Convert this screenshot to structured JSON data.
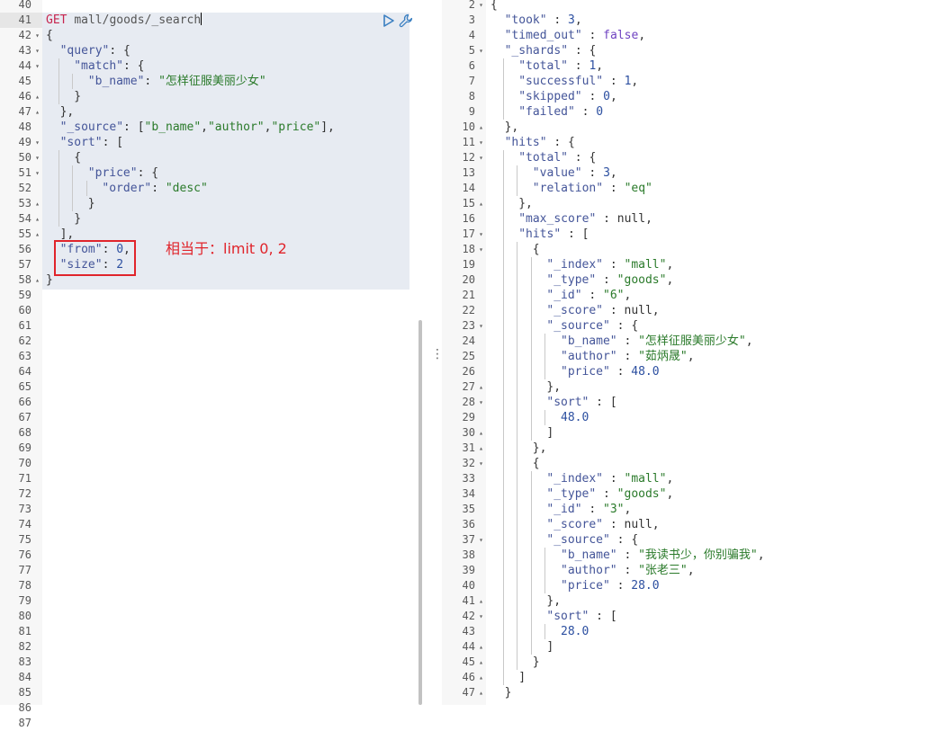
{
  "request": {
    "method": "GET",
    "path": "mall/goods/_search",
    "first_line": 40,
    "lines": [
      [],
      [],
      [
        {
          "t": "p",
          "v": "{"
        }
      ],
      [
        {
          "t": "k",
          "v": "\"query\""
        },
        {
          "t": "p",
          "v": ": {"
        }
      ],
      [
        {
          "t": "k",
          "v": "\"match\""
        },
        {
          "t": "p",
          "v": ": {"
        }
      ],
      [
        {
          "t": "k",
          "v": "\"b_name\""
        },
        {
          "t": "p",
          "v": ": "
        },
        {
          "t": "s",
          "v": "\"怎样征服美丽少女\""
        }
      ],
      [
        {
          "t": "p",
          "v": "}"
        }
      ],
      [
        {
          "t": "p",
          "v": "},"
        }
      ],
      [
        {
          "t": "k",
          "v": "\"_source\""
        },
        {
          "t": "p",
          "v": ": ["
        },
        {
          "t": "s",
          "v": "\"b_name\""
        },
        {
          "t": "p",
          "v": ","
        },
        {
          "t": "s",
          "v": "\"author\""
        },
        {
          "t": "p",
          "v": ","
        },
        {
          "t": "s",
          "v": "\"price\""
        },
        {
          "t": "p",
          "v": "],"
        }
      ],
      [
        {
          "t": "k",
          "v": "\"sort\""
        },
        {
          "t": "p",
          "v": ": ["
        }
      ],
      [
        {
          "t": "p",
          "v": "{"
        }
      ],
      [
        {
          "t": "k",
          "v": "\"price\""
        },
        {
          "t": "p",
          "v": ": {"
        }
      ],
      [
        {
          "t": "k",
          "v": "\"order\""
        },
        {
          "t": "p",
          "v": ": "
        },
        {
          "t": "s",
          "v": "\"desc\""
        }
      ],
      [
        {
          "t": "p",
          "v": "}"
        }
      ],
      [
        {
          "t": "p",
          "v": "}"
        }
      ],
      [
        {
          "t": "p",
          "v": "],"
        }
      ],
      [
        {
          "t": "k",
          "v": "\"from\""
        },
        {
          "t": "p",
          "v": ": "
        },
        {
          "t": "n",
          "v": "0"
        },
        {
          "t": "p",
          "v": ","
        }
      ],
      [
        {
          "t": "k",
          "v": "\"size\""
        },
        {
          "t": "p",
          "v": ": "
        },
        {
          "t": "n",
          "v": "2"
        }
      ],
      [
        {
          "t": "p",
          "v": "}"
        }
      ],
      [],
      [],
      [],
      [],
      [],
      [],
      [],
      [],
      [],
      [],
      [],
      [],
      [],
      [],
      [],
      [],
      [],
      [],
      [],
      [],
      [],
      [],
      [],
      [],
      [],
      [],
      [],
      [],
      []
    ],
    "folds": {
      "42": "down",
      "43": "down",
      "44": "down",
      "46": "up",
      "47": "up",
      "49": "down",
      "50": "down",
      "51": "down",
      "53": "up",
      "54": "up",
      "55": "up",
      "58": "up"
    }
  },
  "annotation": {
    "text": "相当于：limit 0, 2"
  },
  "response": {
    "first_line": 2,
    "lines": [
      [
        {
          "t": "p",
          "v": "{"
        }
      ],
      [
        {
          "t": "k",
          "v": "\"took\""
        },
        {
          "t": "p",
          "v": " : "
        },
        {
          "t": "n",
          "v": "3"
        },
        {
          "t": "p",
          "v": ","
        }
      ],
      [
        {
          "t": "k",
          "v": "\"timed_out\""
        },
        {
          "t": "p",
          "v": " : "
        },
        {
          "t": "b",
          "v": "false"
        },
        {
          "t": "p",
          "v": ","
        }
      ],
      [
        {
          "t": "k",
          "v": "\"_shards\""
        },
        {
          "t": "p",
          "v": " : {"
        }
      ],
      [
        {
          "t": "k",
          "v": "\"total\""
        },
        {
          "t": "p",
          "v": " : "
        },
        {
          "t": "n",
          "v": "1"
        },
        {
          "t": "p",
          "v": ","
        }
      ],
      [
        {
          "t": "k",
          "v": "\"successful\""
        },
        {
          "t": "p",
          "v": " : "
        },
        {
          "t": "n",
          "v": "1"
        },
        {
          "t": "p",
          "v": ","
        }
      ],
      [
        {
          "t": "k",
          "v": "\"skipped\""
        },
        {
          "t": "p",
          "v": " : "
        },
        {
          "t": "n",
          "v": "0"
        },
        {
          "t": "p",
          "v": ","
        }
      ],
      [
        {
          "t": "k",
          "v": "\"failed\""
        },
        {
          "t": "p",
          "v": " : "
        },
        {
          "t": "n",
          "v": "0"
        }
      ],
      [
        {
          "t": "p",
          "v": "},"
        }
      ],
      [
        {
          "t": "k",
          "v": "\"hits\""
        },
        {
          "t": "p",
          "v": " : {"
        }
      ],
      [
        {
          "t": "k",
          "v": "\"total\""
        },
        {
          "t": "p",
          "v": " : {"
        }
      ],
      [
        {
          "t": "k",
          "v": "\"value\""
        },
        {
          "t": "p",
          "v": " : "
        },
        {
          "t": "n",
          "v": "3"
        },
        {
          "t": "p",
          "v": ","
        }
      ],
      [
        {
          "t": "k",
          "v": "\"relation\""
        },
        {
          "t": "p",
          "v": " : "
        },
        {
          "t": "s",
          "v": "\"eq\""
        }
      ],
      [
        {
          "t": "p",
          "v": "},"
        }
      ],
      [
        {
          "t": "k",
          "v": "\"max_score\""
        },
        {
          "t": "p",
          "v": " : null,"
        }
      ],
      [
        {
          "t": "k",
          "v": "\"hits\""
        },
        {
          "t": "p",
          "v": " : ["
        }
      ],
      [
        {
          "t": "p",
          "v": "{"
        }
      ],
      [
        {
          "t": "k",
          "v": "\"_index\""
        },
        {
          "t": "p",
          "v": " : "
        },
        {
          "t": "s",
          "v": "\"mall\""
        },
        {
          "t": "p",
          "v": ","
        }
      ],
      [
        {
          "t": "k",
          "v": "\"_type\""
        },
        {
          "t": "p",
          "v": " : "
        },
        {
          "t": "s",
          "v": "\"goods\""
        },
        {
          "t": "p",
          "v": ","
        }
      ],
      [
        {
          "t": "k",
          "v": "\"_id\""
        },
        {
          "t": "p",
          "v": " : "
        },
        {
          "t": "s",
          "v": "\"6\""
        },
        {
          "t": "p",
          "v": ","
        }
      ],
      [
        {
          "t": "k",
          "v": "\"_score\""
        },
        {
          "t": "p",
          "v": " : null,"
        }
      ],
      [
        {
          "t": "k",
          "v": "\"_source\""
        },
        {
          "t": "p",
          "v": " : {"
        }
      ],
      [
        {
          "t": "k",
          "v": "\"b_name\""
        },
        {
          "t": "p",
          "v": " : "
        },
        {
          "t": "s",
          "v": "\"怎样征服美丽少女\""
        },
        {
          "t": "p",
          "v": ","
        }
      ],
      [
        {
          "t": "k",
          "v": "\"author\""
        },
        {
          "t": "p",
          "v": " : "
        },
        {
          "t": "s",
          "v": "\"茹炳晟\""
        },
        {
          "t": "p",
          "v": ","
        }
      ],
      [
        {
          "t": "k",
          "v": "\"price\""
        },
        {
          "t": "p",
          "v": " : "
        },
        {
          "t": "n",
          "v": "48.0"
        }
      ],
      [
        {
          "t": "p",
          "v": "},"
        }
      ],
      [
        {
          "t": "k",
          "v": "\"sort\""
        },
        {
          "t": "p",
          "v": " : ["
        }
      ],
      [
        {
          "t": "n",
          "v": "48.0"
        }
      ],
      [
        {
          "t": "p",
          "v": "]"
        }
      ],
      [
        {
          "t": "p",
          "v": "},"
        }
      ],
      [
        {
          "t": "p",
          "v": "{"
        }
      ],
      [
        {
          "t": "k",
          "v": "\"_index\""
        },
        {
          "t": "p",
          "v": " : "
        },
        {
          "t": "s",
          "v": "\"mall\""
        },
        {
          "t": "p",
          "v": ","
        }
      ],
      [
        {
          "t": "k",
          "v": "\"_type\""
        },
        {
          "t": "p",
          "v": " : "
        },
        {
          "t": "s",
          "v": "\"goods\""
        },
        {
          "t": "p",
          "v": ","
        }
      ],
      [
        {
          "t": "k",
          "v": "\"_id\""
        },
        {
          "t": "p",
          "v": " : "
        },
        {
          "t": "s",
          "v": "\"3\""
        },
        {
          "t": "p",
          "v": ","
        }
      ],
      [
        {
          "t": "k",
          "v": "\"_score\""
        },
        {
          "t": "p",
          "v": " : null,"
        }
      ],
      [
        {
          "t": "k",
          "v": "\"_source\""
        },
        {
          "t": "p",
          "v": " : {"
        }
      ],
      [
        {
          "t": "k",
          "v": "\"b_name\""
        },
        {
          "t": "p",
          "v": " : "
        },
        {
          "t": "s",
          "v": "\"我读书少，你别骗我\""
        },
        {
          "t": "p",
          "v": ","
        }
      ],
      [
        {
          "t": "k",
          "v": "\"author\""
        },
        {
          "t": "p",
          "v": " : "
        },
        {
          "t": "s",
          "v": "\"张老三\""
        },
        {
          "t": "p",
          "v": ","
        }
      ],
      [
        {
          "t": "k",
          "v": "\"price\""
        },
        {
          "t": "p",
          "v": " : "
        },
        {
          "t": "n",
          "v": "28.0"
        }
      ],
      [
        {
          "t": "p",
          "v": "},"
        }
      ],
      [
        {
          "t": "k",
          "v": "\"sort\""
        },
        {
          "t": "p",
          "v": " : ["
        }
      ],
      [
        {
          "t": "n",
          "v": "28.0"
        }
      ],
      [
        {
          "t": "p",
          "v": "]"
        }
      ],
      [
        {
          "t": "p",
          "v": "}"
        }
      ],
      [
        {
          "t": "p",
          "v": "]"
        }
      ],
      [
        {
          "t": "p",
          "v": "}"
        }
      ]
    ],
    "folds": {
      "2": "down",
      "5": "down",
      "10": "up",
      "11": "down",
      "12": "down",
      "15": "up",
      "17": "down",
      "18": "down",
      "23": "down",
      "27": "up",
      "28": "down",
      "30": "up",
      "31": "up",
      "32": "down",
      "37": "down",
      "41": "up",
      "42": "down",
      "44": "up",
      "45": "up",
      "46": "up",
      "47": "up"
    }
  }
}
